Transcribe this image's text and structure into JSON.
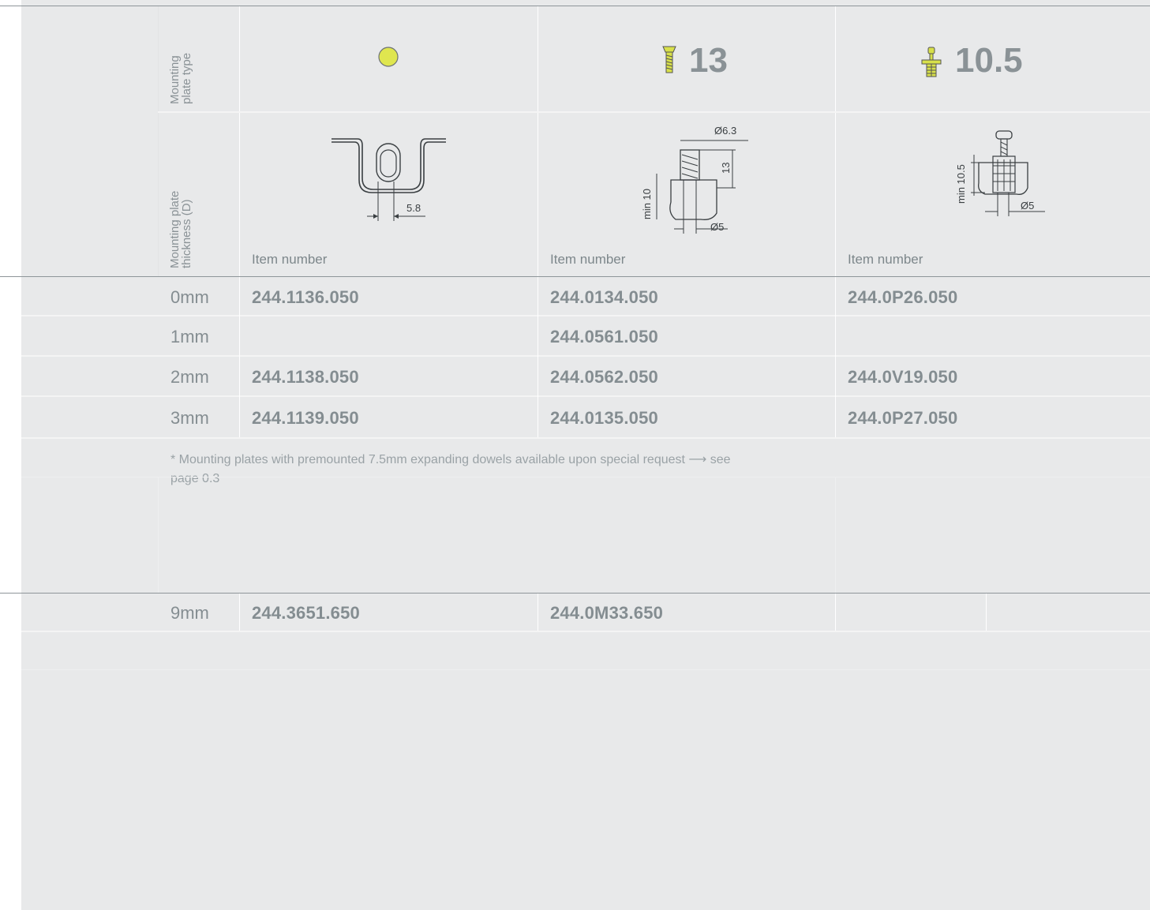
{
  "header": {
    "type_label_line1": "Mounting",
    "type_label_line2": "plate type",
    "thickness_label_line1": "Mounting plate",
    "thickness_label_line2": "thickness (D)",
    "columns": [
      {
        "icon": "yellow-dot-icon",
        "number": ""
      },
      {
        "icon": "screw-icon",
        "number": "13"
      },
      {
        "icon": "expanding-dowel-icon",
        "number": "10.5"
      }
    ],
    "item_number_label": "Item number"
  },
  "drawings": {
    "col1_dim": "5.8",
    "col2_dim_top": "Ø6.3",
    "col2_dim_height": "13",
    "col2_dim_min": "min 10",
    "col2_dim_bottom": "Ø5",
    "col3_dim_min": "min 10.5",
    "col3_dim_bottom": "Ø5"
  },
  "rows": [
    {
      "thickness": "0mm",
      "c1": "244.1136.050",
      "c2": "244.0134.050",
      "c3": "244.0P26.050"
    },
    {
      "thickness": "1mm",
      "c1": "",
      "c2": "244.0561.050",
      "c3": ""
    },
    {
      "thickness": "2mm",
      "c1": "244.1138.050",
      "c2": "244.0562.050",
      "c3": "244.0V19.050"
    },
    {
      "thickness": "3mm",
      "c1": "244.1139.050",
      "c2": "244.0135.050",
      "c3": "244.0P27.050"
    }
  ],
  "note": {
    "line1": "* Mounting plates with premounted 7.5mm expanding dowels available upon special request ⟶ see",
    "line2": "page 0.3"
  },
  "row2": {
    "thickness": "9mm",
    "c1": "244.3651.650",
    "c2": "244.0M33.650",
    "c3": ""
  },
  "colors": {
    "accent_yellow": "#d9e34a",
    "text": "#848d91",
    "background": "#e8e9ea"
  }
}
